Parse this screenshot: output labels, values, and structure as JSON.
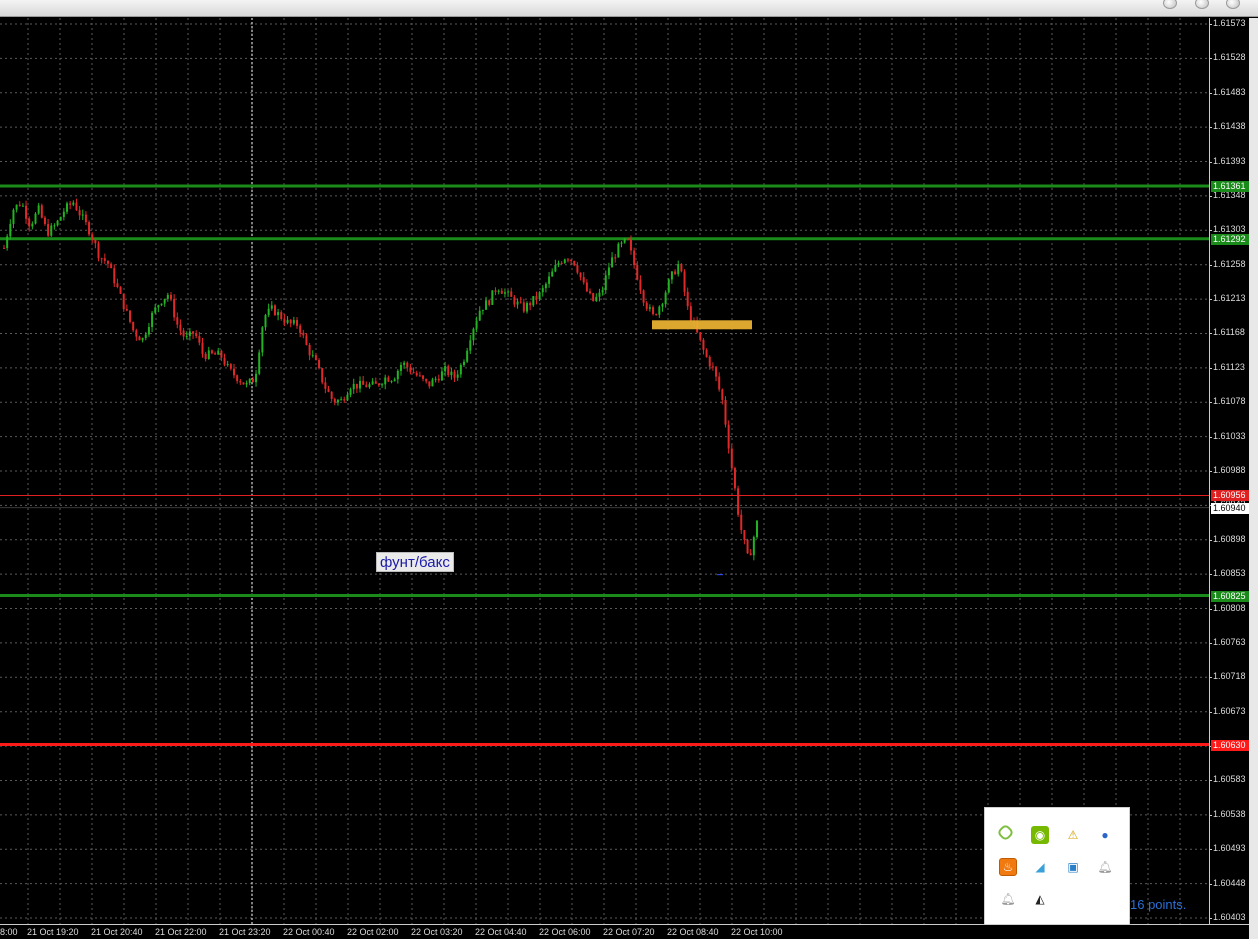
{
  "window": {
    "title_bar_buttons": [
      "minimize",
      "maximize",
      "close"
    ]
  },
  "chart": {
    "symbol_label": "фунт/бакс",
    "status_text": "16 points.",
    "price_ticks": [
      "1.61573",
      "1.61528",
      "1.61483",
      "1.61438",
      "1.61393",
      "1.61348",
      "1.61303",
      "1.61258",
      "1.61213",
      "1.61168",
      "1.61123",
      "1.61078",
      "1.61033",
      "1.60988",
      "1.60943",
      "1.60898",
      "1.60853",
      "1.60808",
      "1.60763",
      "1.60718",
      "1.60673",
      "1.60628",
      "1.60583",
      "1.60538",
      "1.60493",
      "1.60448",
      "1.60403"
    ],
    "time_ticks": [
      "8:00",
      "21 Oct 19:20",
      "21 Oct 20:40",
      "21 Oct 22:00",
      "21 Oct 23:20",
      "22 Oct 00:40",
      "22 Oct 02:00",
      "22 Oct 03:20",
      "22 Oct 04:40",
      "22 Oct 06:00",
      "22 Oct 07:20",
      "22 Oct 08:40",
      "22 Oct 10:00"
    ],
    "horizontal_levels": [
      {
        "name": "resistance-upper",
        "price": "1.61361",
        "color": "#1a8a1a"
      },
      {
        "name": "resistance-lower",
        "price": "1.61292",
        "color": "#1a8a1a"
      },
      {
        "name": "ask-line",
        "price": "1.60956",
        "color": "#e02020"
      },
      {
        "name": "bid-line",
        "price": "1.60940",
        "color": "#ffffff"
      },
      {
        "name": "support-upper",
        "price": "1.60825",
        "color": "#1a8a1a"
      },
      {
        "name": "support-lower",
        "price": "1.60630",
        "color": "#ff1a1a"
      }
    ],
    "colors": {
      "bull": "#22b322",
      "bear": "#e02828",
      "grid": "#5a5a5a",
      "zone": "#e8b030"
    }
  },
  "chart_data": {
    "type": "candlestick",
    "y_range": [
      1.60403,
      1.61573
    ],
    "close_path": [
      1.6128,
      1.6133,
      1.6134,
      1.6131,
      1.6133,
      1.613,
      1.6131,
      1.6133,
      1.6134,
      1.6132,
      1.613,
      1.6127,
      1.6126,
      1.6123,
      1.612,
      1.6117,
      1.6116,
      1.6119,
      1.6121,
      1.6122,
      1.6118,
      1.6116,
      1.6117,
      1.6114,
      1.6114,
      1.6114,
      1.6112,
      1.6111,
      1.611,
      1.6111,
      1.6119,
      1.612,
      1.6119,
      1.6118,
      1.6118,
      1.6115,
      1.6113,
      1.611,
      1.6108,
      1.6108,
      1.611,
      1.611,
      1.611,
      1.611,
      1.6111,
      1.6111,
      1.6113,
      1.6112,
      1.6111,
      1.611,
      1.6111,
      1.6112,
      1.6111,
      1.6113,
      1.6117,
      1.612,
      1.6121,
      1.6123,
      1.6122,
      1.6121,
      1.612,
      1.6121,
      1.6122,
      1.6124,
      1.6126,
      1.6127,
      1.6126,
      1.6123,
      1.6121,
      1.6122,
      1.6126,
      1.6128,
      1.6129,
      1.6125,
      1.6121,
      1.6119,
      1.6121,
      1.6124,
      1.6126,
      1.612,
      1.6117,
      1.6114,
      1.6112,
      1.6108,
      1.61,
      1.6092,
      1.6087,
      1.6092
    ]
  }
}
